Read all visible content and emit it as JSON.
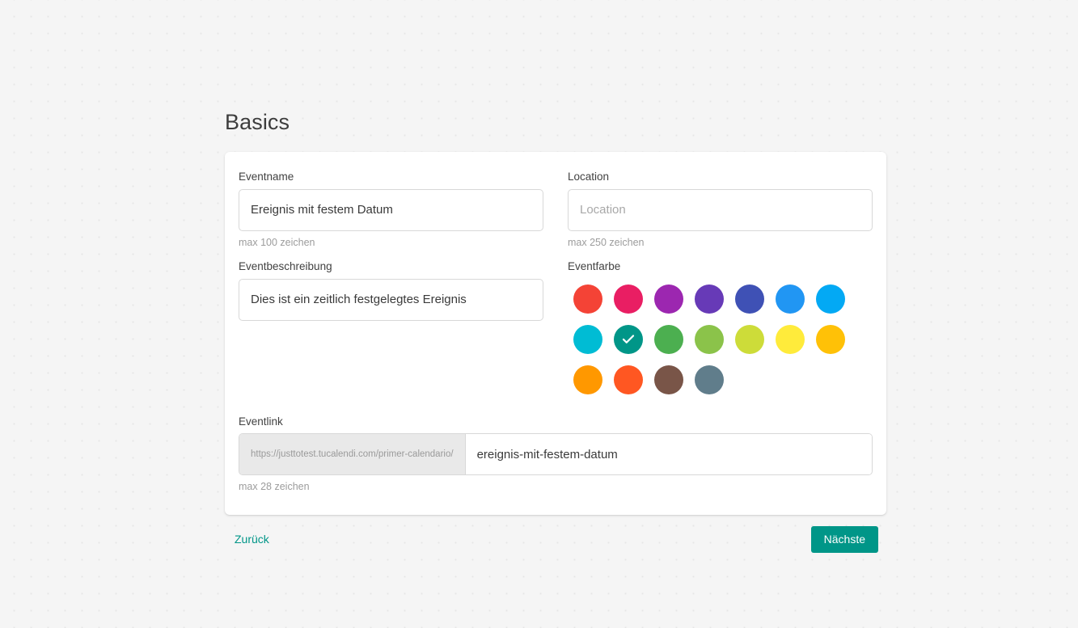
{
  "page": {
    "title": "Basics"
  },
  "form": {
    "event_name": {
      "label": "Eventname",
      "value": "Ereignis mit festem Datum",
      "helper": "max 100 zeichen"
    },
    "event_description": {
      "label": "Eventbeschreibung",
      "value": "Dies ist ein zeitlich festgelegtes Ereignis"
    },
    "location": {
      "label": "Location",
      "value": "",
      "placeholder": "Location",
      "helper": "max 250 zeichen"
    },
    "event_color": {
      "label": "Eventfarbe",
      "selected_index": 8,
      "selected_hex": "#009688",
      "swatches": [
        {
          "name": "red",
          "hex": "#f44336"
        },
        {
          "name": "pink",
          "hex": "#e91e63"
        },
        {
          "name": "purple",
          "hex": "#9c27b0"
        },
        {
          "name": "deep-purple",
          "hex": "#673ab7"
        },
        {
          "name": "indigo",
          "hex": "#3f51b5"
        },
        {
          "name": "blue",
          "hex": "#2196f3"
        },
        {
          "name": "light-blue",
          "hex": "#03a9f4"
        },
        {
          "name": "cyan",
          "hex": "#00bcd4"
        },
        {
          "name": "teal",
          "hex": "#009688"
        },
        {
          "name": "green",
          "hex": "#4caf50"
        },
        {
          "name": "light-green",
          "hex": "#8bc34a"
        },
        {
          "name": "lime",
          "hex": "#cddc39"
        },
        {
          "name": "yellow",
          "hex": "#ffeb3b"
        },
        {
          "name": "amber",
          "hex": "#ffc107"
        },
        {
          "name": "orange",
          "hex": "#ff9800"
        },
        {
          "name": "deep-orange",
          "hex": "#ff5722"
        },
        {
          "name": "brown",
          "hex": "#795548"
        },
        {
          "name": "blue-grey",
          "hex": "#607d8b"
        }
      ]
    },
    "event_link": {
      "label": "Eventlink",
      "prefix": "https://justtotest.tucalendi.com/primer-calendario/",
      "value": "ereignis-mit-festem-datum",
      "helper": "max 28 zeichen"
    }
  },
  "actions": {
    "back_label": "Zurück",
    "next_label": "Nächste",
    "accent_hex": "#009688"
  }
}
